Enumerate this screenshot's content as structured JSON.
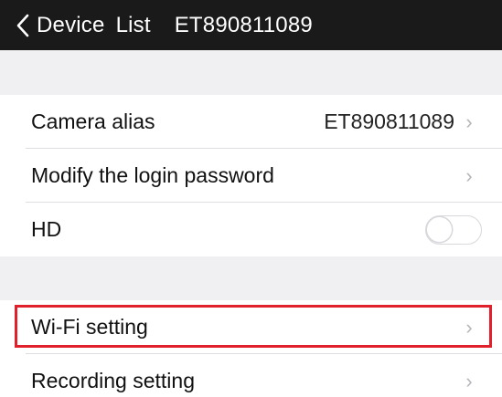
{
  "navbar": {
    "back_label": "Device",
    "title": "List",
    "device_id": "ET890811089"
  },
  "settings_group_1": {
    "camera_alias_label": "Camera alias",
    "camera_alias_value": "ET890811089",
    "modify_password_label": "Modify the login password",
    "hd_label": "HD",
    "hd_enabled": false
  },
  "settings_group_2": {
    "wifi_setting_label": "Wi-Fi setting",
    "recording_setting_label": "Recording setting"
  },
  "chevron_glyph": "›",
  "colors": {
    "navbar_bg": "#1a1a1a",
    "section_gap_bg": "#f0f0f3",
    "highlight_border": "#e0202a"
  }
}
